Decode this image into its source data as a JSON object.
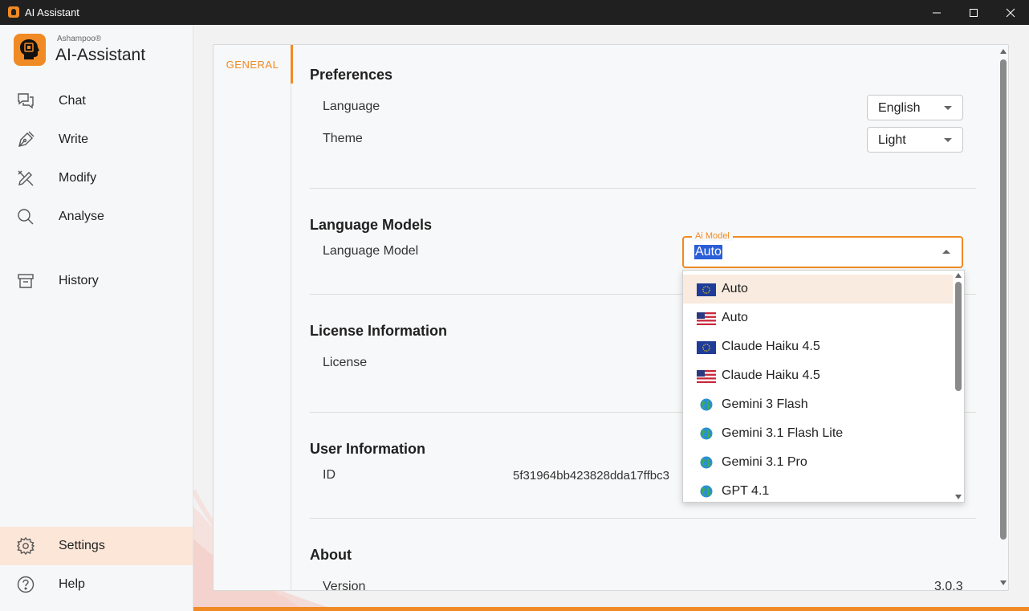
{
  "window": {
    "title": "AI Assistant"
  },
  "brand": {
    "small": "Ashampoo®",
    "name": "AI-Assistant"
  },
  "sidebar": {
    "items": [
      {
        "label": "Chat",
        "icon": "chat-icon"
      },
      {
        "label": "Write",
        "icon": "pen-icon"
      },
      {
        "label": "Modify",
        "icon": "edit-icon"
      },
      {
        "label": "Analyse",
        "icon": "search-icon"
      },
      {
        "label": "History",
        "icon": "archive-icon"
      },
      {
        "label": "Settings",
        "icon": "gear-icon",
        "active": true
      },
      {
        "label": "Help",
        "icon": "help-icon"
      }
    ]
  },
  "tabs": {
    "general": "GENERAL"
  },
  "preferences": {
    "title": "Preferences",
    "language_label": "Language",
    "language_value": "English",
    "theme_label": "Theme",
    "theme_value": "Light"
  },
  "language_models": {
    "title": "Language Models",
    "model_label": "Language Model",
    "field_legend": "Ai Model",
    "field_value": "Auto",
    "options": [
      {
        "label": "Auto",
        "region": "EU"
      },
      {
        "label": "Auto",
        "region": "US"
      },
      {
        "label": "Claude Haiku 4.5",
        "region": "EU"
      },
      {
        "label": "Claude Haiku 4.5",
        "region": "US"
      },
      {
        "label": "Gemini 3 Flash",
        "region": "Global"
      },
      {
        "label": "Gemini 3.1 Flash Lite",
        "region": "Global"
      },
      {
        "label": "Gemini 3.1 Pro",
        "region": "Global"
      },
      {
        "label": "GPT 4.1",
        "region": "Global"
      }
    ]
  },
  "license": {
    "title": "License Information",
    "label": "License"
  },
  "user": {
    "title": "User Information",
    "id_label": "ID",
    "id_value": "5f31964bb423828dda17ffbc3"
  },
  "about": {
    "title": "About",
    "version_label": "Version",
    "version_value": "3.0.3"
  },
  "colors": {
    "accent": "#f08a24",
    "active_bg": "#fbe6d7",
    "selection": "#2b5fd9"
  }
}
